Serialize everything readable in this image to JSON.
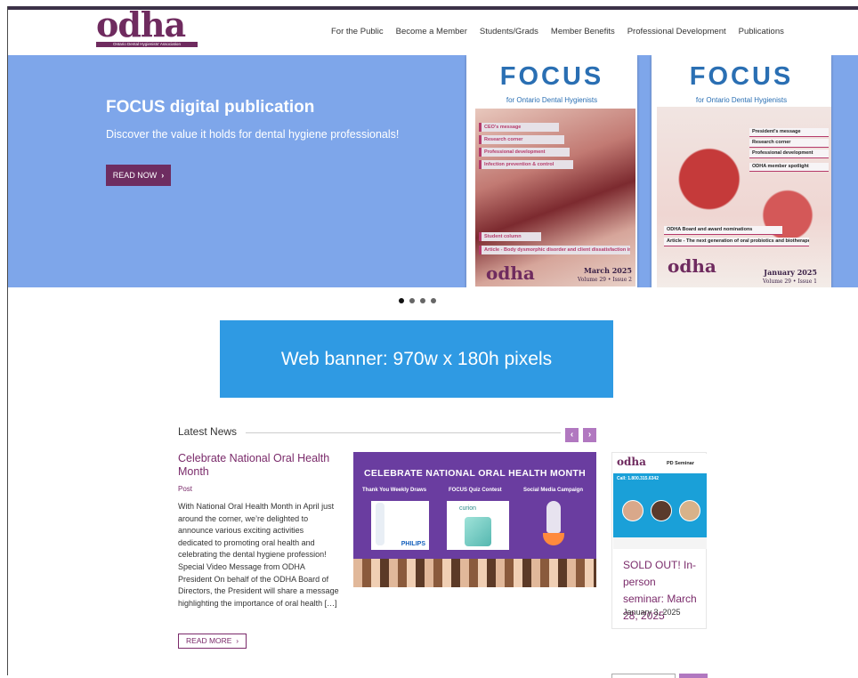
{
  "header": {
    "logo_text": "odha",
    "logo_tagline": "Ontario Dental Hygienists' Association",
    "nav": [
      "For the Public",
      "Become a Member",
      "Students/Grads",
      "Member Benefits",
      "Professional Development",
      "Publications"
    ]
  },
  "hero": {
    "title": "FOCUS digital publication",
    "subtitle": "Discover the value it holds for dental hygiene professionals!",
    "button_label": "READ NOW",
    "button_arrow": "›",
    "cover1": {
      "title": "FOCUS",
      "subtitle": "for Ontario Dental Hygienists",
      "tags": [
        "CEO's message",
        "Research corner",
        "Professional development",
        "Infection prevention & control",
        "Student column",
        "Article - Body dysmorphic disorder and client dissatisfaction in oral healthcare"
      ],
      "logo": "odha",
      "date": "March 2025",
      "volume": "Volume 29 • Issue 2"
    },
    "cover2": {
      "title": "FOCUS",
      "subtitle": "for Ontario Dental Hygienists",
      "tags": [
        "President's message",
        "Research corner",
        "Professional development",
        "ODHA member spotlight",
        "ODHA Board and award nominations",
        "Article - The next generation of oral probiotics and biotherapeutics"
      ],
      "logo": "odha",
      "date": "January 2025",
      "volume": "Volume 29 • Issue 1"
    }
  },
  "banner": {
    "text": "Web banner: 970w x 180h pixels"
  },
  "latest_news": {
    "heading": "Latest News",
    "prev": "‹",
    "next": "›",
    "article": {
      "title": "Celebrate National Oral Health Month",
      "type": "Post",
      "body": "With National Oral Health Month in April just around the corner, we’re delighted to announce various exciting activities dedicated to promoting oral health and celebrating the dental hygiene profession! Special Video Message from ODHA President On behalf of the ODHA Board of Directors, the President will share a message highlighting the importance of oral health […]",
      "read_more": "READ MORE",
      "read_more_arrow": "›",
      "image": {
        "heading": "CELEBRATE NATIONAL ORAL HEALTH MONTH",
        "captions": [
          "Thank You Weekly Draws",
          "FOCUS Quiz Contest",
          "Social Media Campaign"
        ],
        "brands": [
          "PHILIPS",
          "curion"
        ]
      }
    },
    "card": {
      "logo": "odha",
      "label": "PD Seminar",
      "call": "Call: 1.800.315.6342",
      "title": "SOLD OUT! In-person seminar: March 28, 2025",
      "date": "January 3, 2025"
    }
  },
  "colors": {
    "brand": "#6f2b5f",
    "hero_bg": "#7ea6ea",
    "banner_bg": "#2f9ae3",
    "arrow_bg": "#b178c0"
  }
}
